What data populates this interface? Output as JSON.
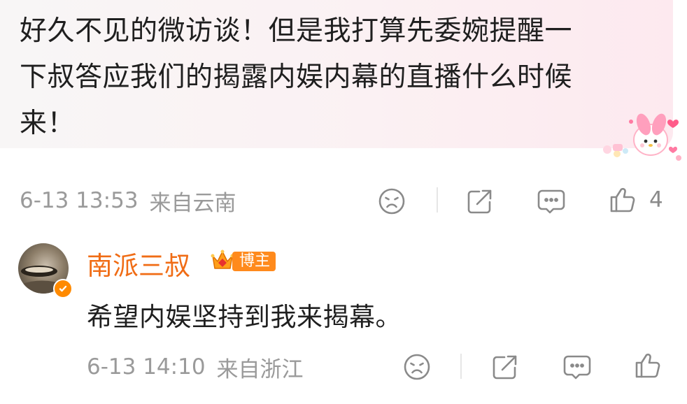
{
  "comment": {
    "text_line1": "好久不见的微访谈！但是我打算先委婉提醒一",
    "text_line2": "下叔答应我们的揭露内娱内幕的直播什么时候",
    "text_line3": "来！",
    "timestamp": "6-13 13:53",
    "location": "来自云南",
    "like_count": "4",
    "sticker": "my-melody-sticker"
  },
  "reply": {
    "username": "南派三叔",
    "badge_label": "博主",
    "text": "希望内娱坚持到我来揭幕。",
    "timestamp": "6-13 14:10",
    "location": "来自浙江"
  },
  "icons": {
    "dislike": "frown-face-icon",
    "share": "share-icon",
    "comment": "comment-bubble-icon",
    "like": "thumbs-up-icon",
    "verified": "verified-check-icon",
    "crown": "crown-icon"
  },
  "colors": {
    "username": "#f06c15",
    "badge": "#ff8a1c",
    "meta_gray": "#9a9a9a",
    "icon_gray": "#8a8a8a",
    "bubble_bg": "#fbf1f3"
  }
}
